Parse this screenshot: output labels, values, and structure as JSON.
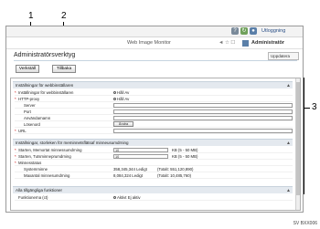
{
  "callouts": [
    "1",
    "2",
    "3"
  ],
  "header": {
    "logout_label": "Utloggning",
    "app_title": "Web Image Monitor",
    "nav_label": "◄ ☆ ☐",
    "admin_label": "Administratör"
  },
  "page": {
    "title": "Administratörsverktyg",
    "lang_select": "Uppdatera"
  },
  "toolbar": {
    "ok_label": "Verkställ",
    "cancel_label": "Tillbaka"
  },
  "sections": {
    "web_title": "Inställningar för webbinställaren",
    "dump_title": "Inställningar, storleken för meminnetsflätsaf minneusumdrning",
    "other_title": "Alla tillgängliga funktioner"
  },
  "web_rows": [
    {
      "label": "Inställningar för webbinställaren",
      "val": "Håll Av"
    },
    {
      "label": "HTTP-proxy",
      "val": "Håll Av"
    },
    {
      "label": "Server",
      "val": ""
    },
    {
      "label": "Port",
      "val": ""
    },
    {
      "label": "Användarnamn",
      "val": ""
    },
    {
      "label": "Lösenord",
      "val": "Ändra"
    },
    {
      "label": "URL",
      "val": ""
    }
  ],
  "dump_rows": [
    {
      "label": "Starten, Memortat minnessumdrning",
      "val": "10",
      "unit": "KB (5 - 50 MB)"
    },
    {
      "label": "Starten, Tutsminneprumdrning",
      "val": "10",
      "unit": "KB (5 - 50 MB)"
    },
    {
      "label": "Minnesstatus",
      "val": "",
      "unit": ""
    },
    {
      "label": "Systemminne",
      "val": "358,345,344 Ledigt",
      "unit": "(Totalt: 551,120,890)"
    },
    {
      "label": "Maxantal minnesumdrning",
      "val": "8,084,324 Ledigt",
      "unit": "(Totalt: 10,485,760)"
    }
  ],
  "other_rows": [
    {
      "label": "Funktionerna (ct)",
      "val": "Aktivt    Ej aktiv"
    }
  ],
  "figure_code": "SV BXX006"
}
